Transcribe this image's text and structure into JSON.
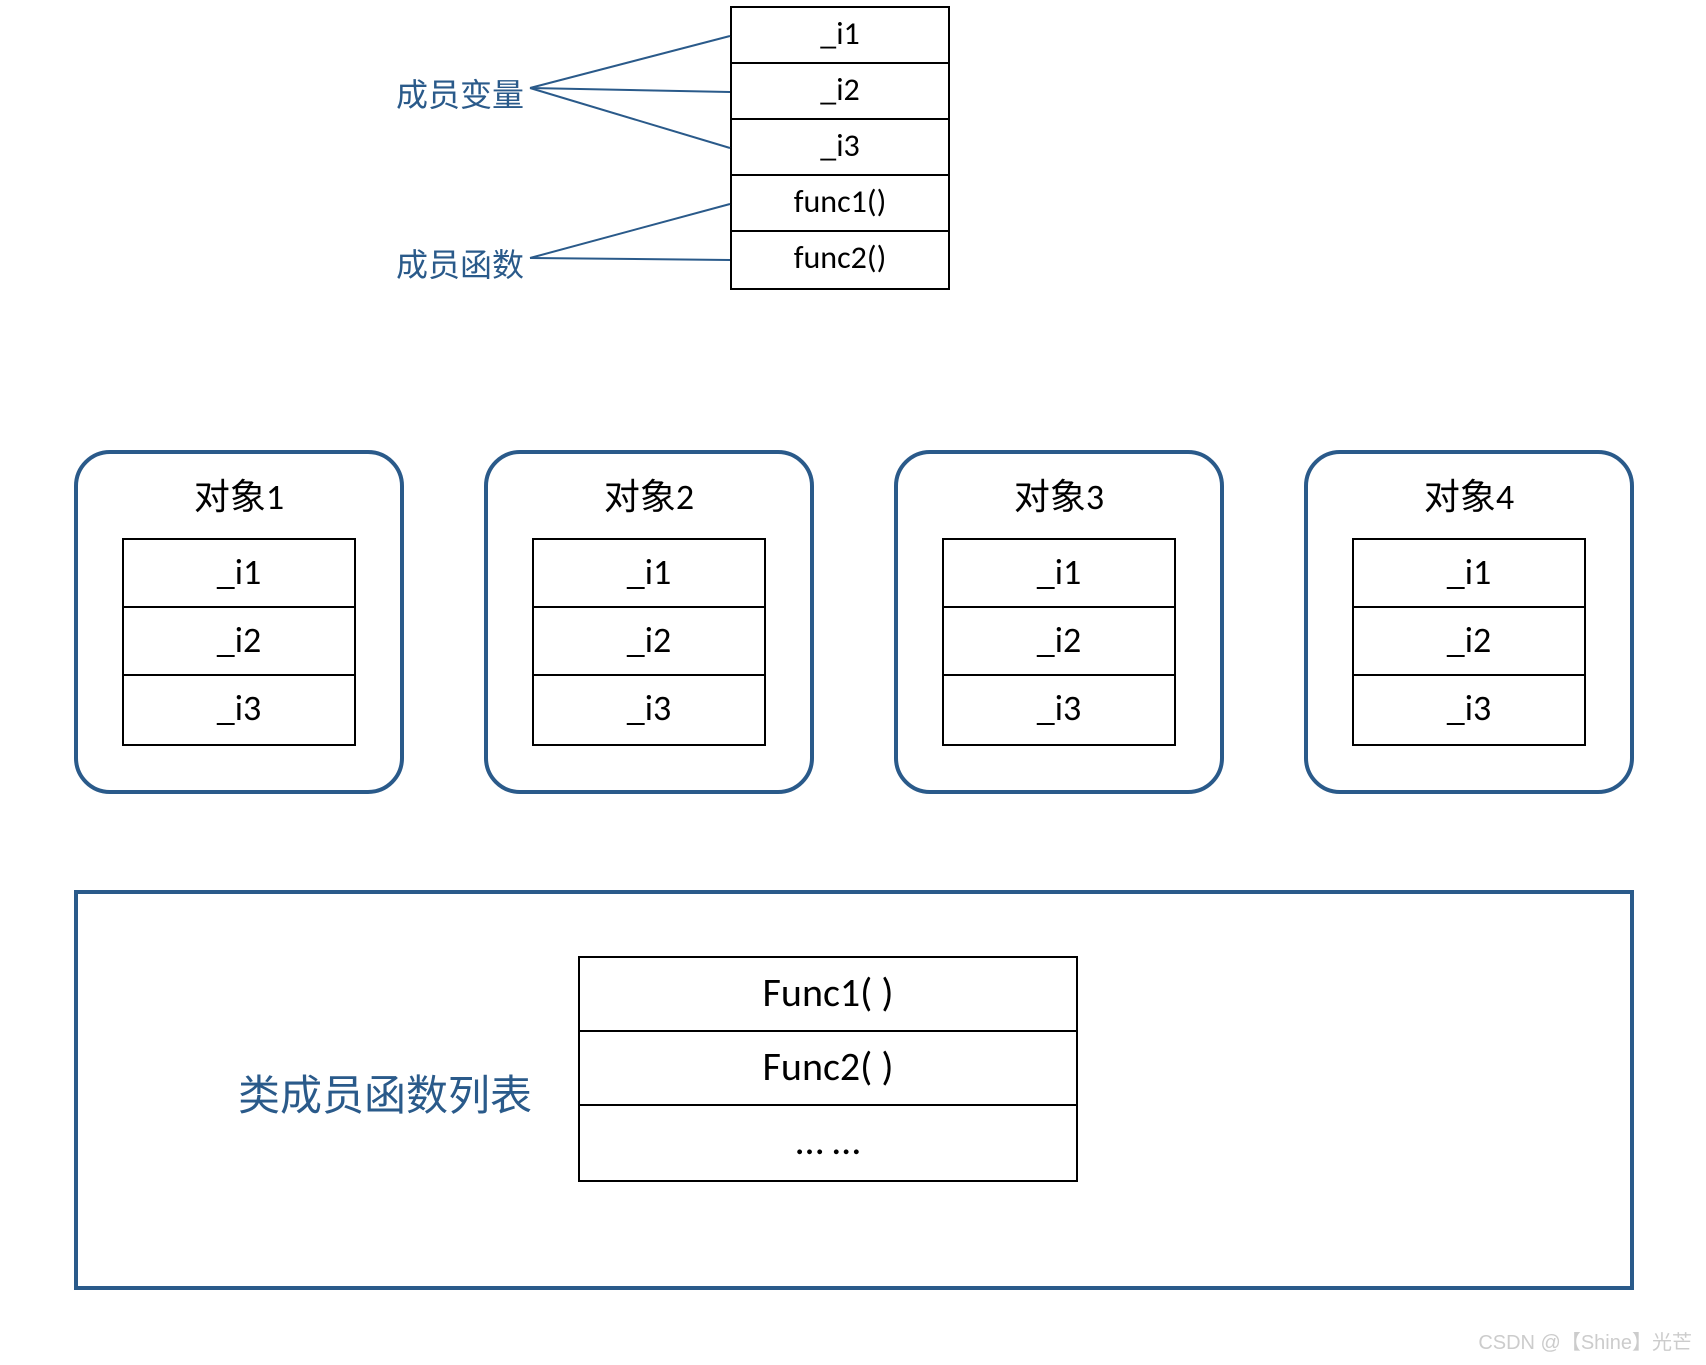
{
  "top_labels": {
    "member_vars": "成员变量",
    "member_funcs": "成员函数"
  },
  "top_stack": [
    "_i1",
    "_i2",
    "_i3",
    "func1()",
    "func2()"
  ],
  "objects": [
    {
      "title": "对象1",
      "rows": [
        "_i1",
        "_i2",
        "_i3"
      ]
    },
    {
      "title": "对象2",
      "rows": [
        "_i1",
        "_i2",
        "_i3"
      ]
    },
    {
      "title": "对象3",
      "rows": [
        "_i1",
        "_i2",
        "_i3"
      ]
    },
    {
      "title": "对象4",
      "rows": [
        "_i1",
        "_i2",
        "_i3"
      ]
    }
  ],
  "func_table": {
    "label": "类成员函数列表",
    "rows": [
      "Func1( )",
      "Func2( )",
      "… …"
    ]
  },
  "watermark": "CSDN @【Shine】光芒"
}
